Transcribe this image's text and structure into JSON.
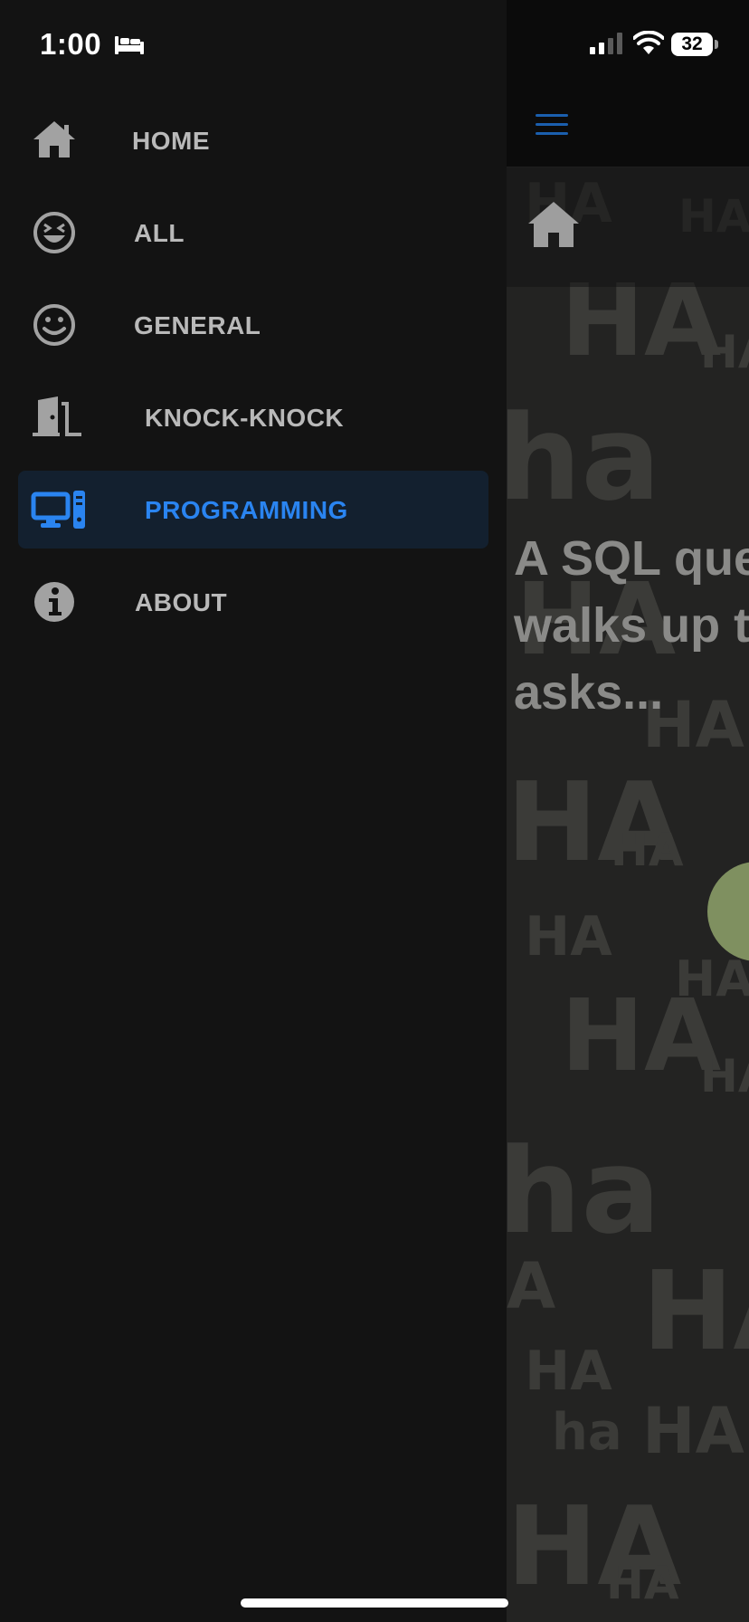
{
  "status_bar": {
    "time": "1:00",
    "battery": "32"
  },
  "drawer": {
    "items": [
      {
        "label": "HOME",
        "icon": "home-icon",
        "active": false
      },
      {
        "label": "ALL",
        "icon": "laughing-face-icon",
        "active": false
      },
      {
        "label": "GENERAL",
        "icon": "smile-icon",
        "active": false
      },
      {
        "label": "KNOCK-KNOCK",
        "icon": "door-icon",
        "active": false
      },
      {
        "label": "PROGRAMMING",
        "icon": "computer-icon",
        "active": true
      },
      {
        "label": "ABOUT",
        "icon": "info-icon",
        "active": false
      }
    ]
  },
  "main": {
    "joke_preview": "A SQL que\nwalks up t\nasks..."
  },
  "colors": {
    "accent": "#2a84f0",
    "drawer_bg": "#131313",
    "active_bg": "#13202f",
    "text": "#b9b9b9",
    "fab": "#7f9060"
  }
}
